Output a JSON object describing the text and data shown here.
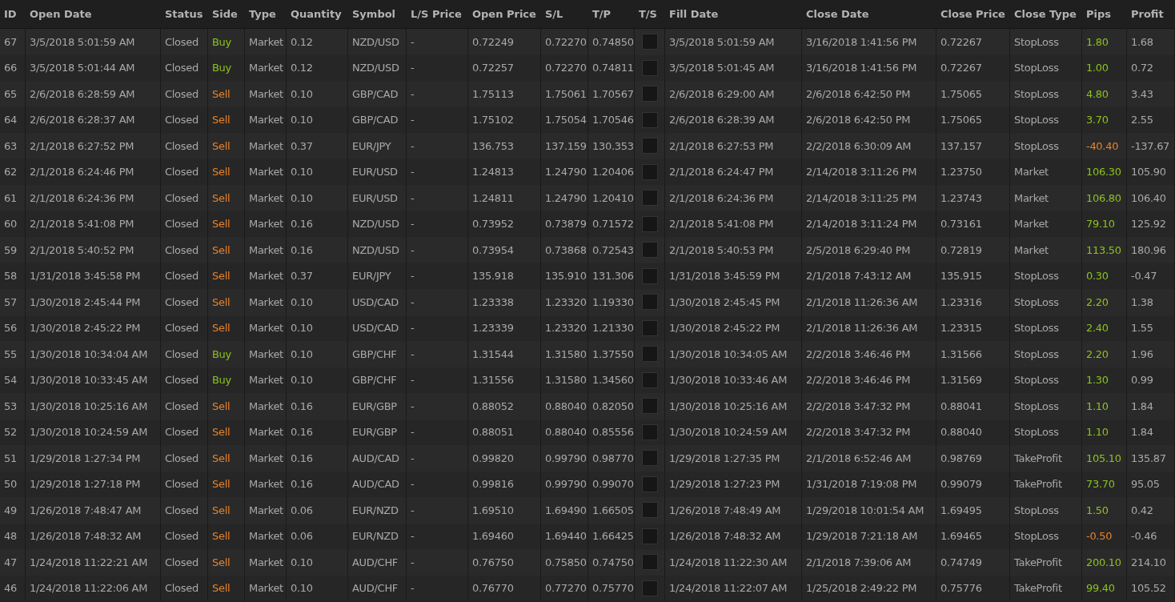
{
  "table": {
    "columns": [
      "ID",
      "Open Date",
      "Status",
      "Side",
      "Type",
      "Quantity",
      "Symbol",
      "L/S Price",
      "Open Price",
      "S/L",
      "T/P",
      "T/S",
      "Fill Date",
      "Close Date",
      "Close Price",
      "Close Type",
      "Pips",
      "Profit"
    ],
    "rows": [
      {
        "id": "67",
        "open_date": "3/5/2018 5:01:59 AM",
        "status": "Closed",
        "side": {
          "text": "Buy",
          "color": "#8cc21e"
        },
        "type": "Market",
        "quantity": "0.12",
        "symbol": "NZD/USD",
        "ls_price": "-",
        "open_price": "0.72249",
        "sl": "0.72270",
        "tp": "0.74850",
        "ts_checked": false,
        "fill_date": "3/5/2018 5:01:59 AM",
        "close_date": "3/16/2018 1:41:56 PM",
        "close_price": "0.72267",
        "close_type": "StopLoss",
        "pips": {
          "text": "1.80",
          "color": "#8cc21e"
        },
        "profit": "1.68"
      },
      {
        "id": "66",
        "open_date": "3/5/2018 5:01:44 AM",
        "status": "Closed",
        "side": {
          "text": "Buy",
          "color": "#8cc21e"
        },
        "type": "Market",
        "quantity": "0.12",
        "symbol": "NZD/USD",
        "ls_price": "-",
        "open_price": "0.72257",
        "sl": "0.72270",
        "tp": "0.74811",
        "ts_checked": false,
        "fill_date": "3/5/2018 5:01:45 AM",
        "close_date": "3/16/2018 1:41:56 PM",
        "close_price": "0.72267",
        "close_type": "StopLoss",
        "pips": {
          "text": "1.00",
          "color": "#8cc21e"
        },
        "profit": "0.72"
      },
      {
        "id": "65",
        "open_date": "2/6/2018 6:28:59 AM",
        "status": "Closed",
        "side": {
          "text": "Sell",
          "color": "#e8832a"
        },
        "type": "Market",
        "quantity": "0.10",
        "symbol": "GBP/CAD",
        "ls_price": "-",
        "open_price": "1.75113",
        "sl": "1.75061",
        "tp": "1.70567",
        "ts_checked": false,
        "fill_date": "2/6/2018 6:29:00 AM",
        "close_date": "2/6/2018 6:42:50 PM",
        "close_price": "1.75065",
        "close_type": "StopLoss",
        "pips": {
          "text": "4.80",
          "color": "#8cc21e"
        },
        "profit": "3.43"
      },
      {
        "id": "64",
        "open_date": "2/6/2018 6:28:37 AM",
        "status": "Closed",
        "side": {
          "text": "Sell",
          "color": "#e8832a"
        },
        "type": "Market",
        "quantity": "0.10",
        "symbol": "GBP/CAD",
        "ls_price": "-",
        "open_price": "1.75102",
        "sl": "1.75054",
        "tp": "1.70546",
        "ts_checked": false,
        "fill_date": "2/6/2018 6:28:39 AM",
        "close_date": "2/6/2018 6:42:50 PM",
        "close_price": "1.75065",
        "close_type": "StopLoss",
        "pips": {
          "text": "3.70",
          "color": "#8cc21e"
        },
        "profit": "2.55"
      },
      {
        "id": "63",
        "open_date": "2/1/2018 6:27:52 PM",
        "status": "Closed",
        "side": {
          "text": "Sell",
          "color": "#e8832a"
        },
        "type": "Market",
        "quantity": "0.37",
        "symbol": "EUR/JPY",
        "ls_price": "-",
        "open_price": "136.753",
        "sl": "137.159",
        "tp": "130.353",
        "ts_checked": false,
        "fill_date": "2/1/2018 6:27:53 PM",
        "close_date": "2/2/2018 6:30:09 AM",
        "close_price": "137.157",
        "close_type": "StopLoss",
        "pips": {
          "text": "-40.40",
          "color": "#e8832a"
        },
        "profit": "-137.67"
      },
      {
        "id": "62",
        "open_date": "2/1/2018 6:24:46 PM",
        "status": "Closed",
        "side": {
          "text": "Sell",
          "color": "#e8832a"
        },
        "type": "Market",
        "quantity": "0.10",
        "symbol": "EUR/USD",
        "ls_price": "-",
        "open_price": "1.24813",
        "sl": "1.24790",
        "tp": "1.20406",
        "ts_checked": false,
        "fill_date": "2/1/2018 6:24:47 PM",
        "close_date": "2/14/2018 3:11:26 PM",
        "close_price": "1.23750",
        "close_type": "Market",
        "pips": {
          "text": "106.30",
          "color": "#8cc21e"
        },
        "profit": "105.90"
      },
      {
        "id": "61",
        "open_date": "2/1/2018 6:24:36 PM",
        "status": "Closed",
        "side": {
          "text": "Sell",
          "color": "#e8832a"
        },
        "type": "Market",
        "quantity": "0.10",
        "symbol": "EUR/USD",
        "ls_price": "-",
        "open_price": "1.24811",
        "sl": "1.24790",
        "tp": "1.20410",
        "ts_checked": false,
        "fill_date": "2/1/2018 6:24:36 PM",
        "close_date": "2/14/2018 3:11:25 PM",
        "close_price": "1.23743",
        "close_type": "Market",
        "pips": {
          "text": "106.80",
          "color": "#8cc21e"
        },
        "profit": "106.40"
      },
      {
        "id": "60",
        "open_date": "2/1/2018 5:41:08 PM",
        "status": "Closed",
        "side": {
          "text": "Sell",
          "color": "#e8832a"
        },
        "type": "Market",
        "quantity": "0.16",
        "symbol": "NZD/USD",
        "ls_price": "-",
        "open_price": "0.73952",
        "sl": "0.73879",
        "tp": "0.71572",
        "ts_checked": false,
        "fill_date": "2/1/2018 5:41:08 PM",
        "close_date": "2/14/2018 3:11:24 PM",
        "close_price": "0.73161",
        "close_type": "Market",
        "pips": {
          "text": "79.10",
          "color": "#8cc21e"
        },
        "profit": "125.92"
      },
      {
        "id": "59",
        "open_date": "2/1/2018 5:40:52 PM",
        "status": "Closed",
        "side": {
          "text": "Sell",
          "color": "#e8832a"
        },
        "type": "Market",
        "quantity": "0.16",
        "symbol": "NZD/USD",
        "ls_price": "-",
        "open_price": "0.73954",
        "sl": "0.73868",
        "tp": "0.72543",
        "ts_checked": false,
        "fill_date": "2/1/2018 5:40:53 PM",
        "close_date": "2/5/2018 6:29:40 PM",
        "close_price": "0.72819",
        "close_type": "Market",
        "pips": {
          "text": "113.50",
          "color": "#8cc21e"
        },
        "profit": "180.96"
      },
      {
        "id": "58",
        "open_date": "1/31/2018 3:45:58 PM",
        "status": "Closed",
        "side": {
          "text": "Sell",
          "color": "#e8832a"
        },
        "type": "Market",
        "quantity": "0.37",
        "symbol": "EUR/JPY",
        "ls_price": "-",
        "open_price": "135.918",
        "sl": "135.910",
        "tp": "131.306",
        "ts_checked": false,
        "fill_date": "1/31/2018 3:45:59 PM",
        "close_date": "2/1/2018 7:43:12 AM",
        "close_price": "135.915",
        "close_type": "StopLoss",
        "pips": {
          "text": "0.30",
          "color": "#8cc21e"
        },
        "profit": "-0.47"
      },
      {
        "id": "57",
        "open_date": "1/30/2018 2:45:44 PM",
        "status": "Closed",
        "side": {
          "text": "Sell",
          "color": "#e8832a"
        },
        "type": "Market",
        "quantity": "0.10",
        "symbol": "USD/CAD",
        "ls_price": "-",
        "open_price": "1.23338",
        "sl": "1.23320",
        "tp": "1.19330",
        "ts_checked": false,
        "fill_date": "1/30/2018 2:45:45 PM",
        "close_date": "2/1/2018 11:26:36 AM",
        "close_price": "1.23316",
        "close_type": "StopLoss",
        "pips": {
          "text": "2.20",
          "color": "#8cc21e"
        },
        "profit": "1.38"
      },
      {
        "id": "56",
        "open_date": "1/30/2018 2:45:22 PM",
        "status": "Closed",
        "side": {
          "text": "Sell",
          "color": "#e8832a"
        },
        "type": "Market",
        "quantity": "0.10",
        "symbol": "USD/CAD",
        "ls_price": "-",
        "open_price": "1.23339",
        "sl": "1.23320",
        "tp": "1.21330",
        "ts_checked": false,
        "fill_date": "1/30/2018 2:45:22 PM",
        "close_date": "2/1/2018 11:26:36 AM",
        "close_price": "1.23315",
        "close_type": "StopLoss",
        "pips": {
          "text": "2.40",
          "color": "#8cc21e"
        },
        "profit": "1.55"
      },
      {
        "id": "55",
        "open_date": "1/30/2018 10:34:04 AM",
        "status": "Closed",
        "side": {
          "text": "Buy",
          "color": "#8cc21e"
        },
        "type": "Market",
        "quantity": "0.10",
        "symbol": "GBP/CHF",
        "ls_price": "-",
        "open_price": "1.31544",
        "sl": "1.31580",
        "tp": "1.37550",
        "ts_checked": false,
        "fill_date": "1/30/2018 10:34:05 AM",
        "close_date": "2/2/2018 3:46:46 PM",
        "close_price": "1.31566",
        "close_type": "StopLoss",
        "pips": {
          "text": "2.20",
          "color": "#8cc21e"
        },
        "profit": "1.96"
      },
      {
        "id": "54",
        "open_date": "1/30/2018 10:33:45 AM",
        "status": "Closed",
        "side": {
          "text": "Buy",
          "color": "#8cc21e"
        },
        "type": "Market",
        "quantity": "0.10",
        "symbol": "GBP/CHF",
        "ls_price": "-",
        "open_price": "1.31556",
        "sl": "1.31580",
        "tp": "1.34560",
        "ts_checked": false,
        "fill_date": "1/30/2018 10:33:46 AM",
        "close_date": "2/2/2018 3:46:46 PM",
        "close_price": "1.31569",
        "close_type": "StopLoss",
        "pips": {
          "text": "1.30",
          "color": "#8cc21e"
        },
        "profit": "0.99"
      },
      {
        "id": "53",
        "open_date": "1/30/2018 10:25:16 AM",
        "status": "Closed",
        "side": {
          "text": "Sell",
          "color": "#e8832a"
        },
        "type": "Market",
        "quantity": "0.16",
        "symbol": "EUR/GBP",
        "ls_price": "-",
        "open_price": "0.88052",
        "sl": "0.88040",
        "tp": "0.82050",
        "ts_checked": false,
        "fill_date": "1/30/2018 10:25:16 AM",
        "close_date": "2/2/2018 3:47:32 PM",
        "close_price": "0.88041",
        "close_type": "StopLoss",
        "pips": {
          "text": "1.10",
          "color": "#8cc21e"
        },
        "profit": "1.84"
      },
      {
        "id": "52",
        "open_date": "1/30/2018 10:24:59 AM",
        "status": "Closed",
        "side": {
          "text": "Sell",
          "color": "#e8832a"
        },
        "type": "Market",
        "quantity": "0.16",
        "symbol": "EUR/GBP",
        "ls_price": "-",
        "open_price": "0.88051",
        "sl": "0.88040",
        "tp": "0.85556",
        "ts_checked": false,
        "fill_date": "1/30/2018 10:24:59 AM",
        "close_date": "2/2/2018 3:47:32 PM",
        "close_price": "0.88040",
        "close_type": "StopLoss",
        "pips": {
          "text": "1.10",
          "color": "#8cc21e"
        },
        "profit": "1.84"
      },
      {
        "id": "51",
        "open_date": "1/29/2018 1:27:34 PM",
        "status": "Closed",
        "side": {
          "text": "Sell",
          "color": "#e8832a"
        },
        "type": "Market",
        "quantity": "0.16",
        "symbol": "AUD/CAD",
        "ls_price": "-",
        "open_price": "0.99820",
        "sl": "0.99790",
        "tp": "0.98770",
        "ts_checked": false,
        "fill_date": "1/29/2018 1:27:35 PM",
        "close_date": "2/1/2018 6:52:46 AM",
        "close_price": "0.98769",
        "close_type": "TakeProfit",
        "pips": {
          "text": "105.10",
          "color": "#8cc21e"
        },
        "profit": "135.87"
      },
      {
        "id": "50",
        "open_date": "1/29/2018 1:27:18 PM",
        "status": "Closed",
        "side": {
          "text": "Sell",
          "color": "#e8832a"
        },
        "type": "Market",
        "quantity": "0.16",
        "symbol": "AUD/CAD",
        "ls_price": "-",
        "open_price": "0.99816",
        "sl": "0.99790",
        "tp": "0.99070",
        "ts_checked": false,
        "fill_date": "1/29/2018 1:27:23 PM",
        "close_date": "1/31/2018 7:19:08 PM",
        "close_price": "0.99079",
        "close_type": "TakeProfit",
        "pips": {
          "text": "73.70",
          "color": "#8cc21e"
        },
        "profit": "95.05"
      },
      {
        "id": "49",
        "open_date": "1/26/2018 7:48:47 AM",
        "status": "Closed",
        "side": {
          "text": "Sell",
          "color": "#e8832a"
        },
        "type": "Market",
        "quantity": "0.06",
        "symbol": "EUR/NZD",
        "ls_price": "-",
        "open_price": "1.69510",
        "sl": "1.69490",
        "tp": "1.66505",
        "ts_checked": false,
        "fill_date": "1/26/2018 7:48:49 AM",
        "close_date": "1/29/2018 10:01:54 AM",
        "close_price": "1.69495",
        "close_type": "StopLoss",
        "pips": {
          "text": "1.50",
          "color": "#8cc21e"
        },
        "profit": "0.42"
      },
      {
        "id": "48",
        "open_date": "1/26/2018 7:48:32 AM",
        "status": "Closed",
        "side": {
          "text": "Sell",
          "color": "#e8832a"
        },
        "type": "Market",
        "quantity": "0.06",
        "symbol": "EUR/NZD",
        "ls_price": "-",
        "open_price": "1.69460",
        "sl": "1.69440",
        "tp": "1.66425",
        "ts_checked": false,
        "fill_date": "1/26/2018 7:48:32 AM",
        "close_date": "1/29/2018 7:21:18 AM",
        "close_price": "1.69465",
        "close_type": "StopLoss",
        "pips": {
          "text": "-0.50",
          "color": "#e8832a"
        },
        "profit": "-0.46"
      },
      {
        "id": "47",
        "open_date": "1/24/2018 11:22:21 AM",
        "status": "Closed",
        "side": {
          "text": "Sell",
          "color": "#e8832a"
        },
        "type": "Market",
        "quantity": "0.10",
        "symbol": "AUD/CHF",
        "ls_price": "-",
        "open_price": "0.76750",
        "sl": "0.75850",
        "tp": "0.74750",
        "ts_checked": false,
        "fill_date": "1/24/2018 11:22:30 AM",
        "close_date": "2/1/2018 7:39:06 AM",
        "close_price": "0.74749",
        "close_type": "TakeProfit",
        "pips": {
          "text": "200.10",
          "color": "#8cc21e"
        },
        "profit": "214.10"
      },
      {
        "id": "46",
        "open_date": "1/24/2018 11:22:06 AM",
        "status": "Closed",
        "side": {
          "text": "Sell",
          "color": "#e8832a"
        },
        "type": "Market",
        "quantity": "0.10",
        "symbol": "AUD/CHF",
        "ls_price": "-",
        "open_price": "0.76770",
        "sl": "0.77270",
        "tp": "0.75770",
        "ts_checked": false,
        "fill_date": "1/24/2018 11:22:07 AM",
        "close_date": "1/25/2018 2:49:22 PM",
        "close_price": "0.75776",
        "close_type": "TakeProfit",
        "pips": {
          "text": "99.40",
          "color": "#8cc21e"
        },
        "profit": "105.52"
      }
    ]
  }
}
